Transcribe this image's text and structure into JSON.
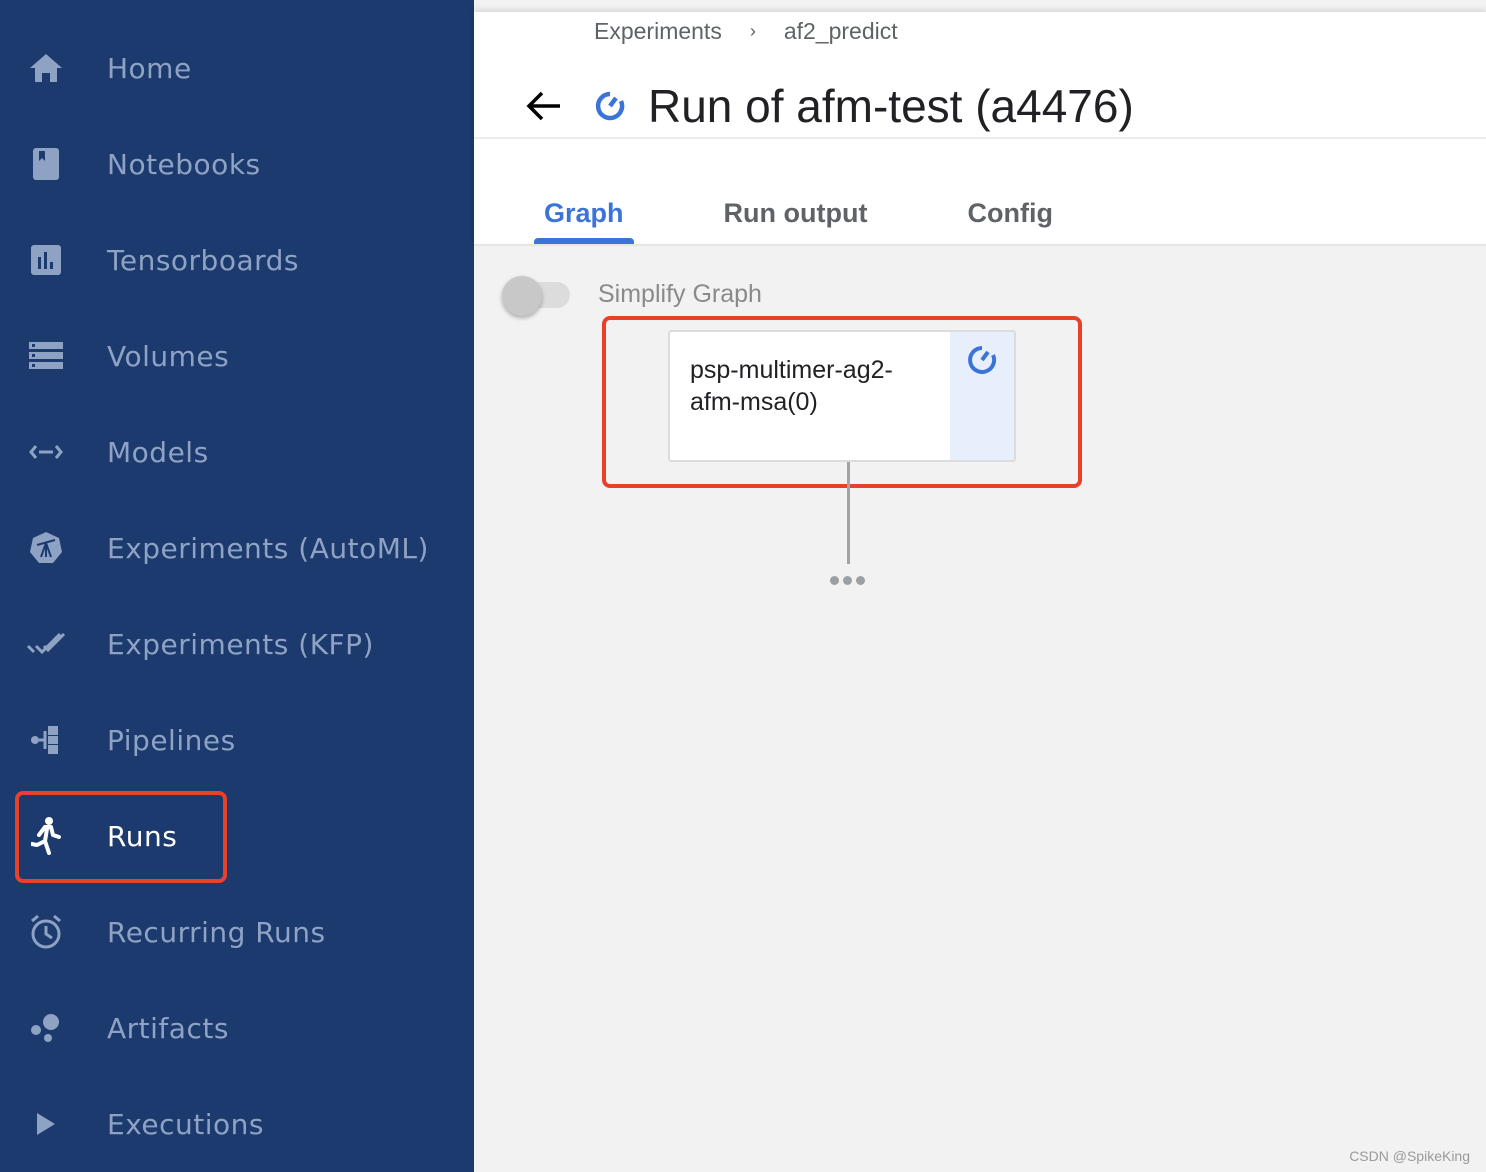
{
  "sidebar": {
    "items": [
      {
        "label": "Home",
        "icon": "home-icon",
        "active": false
      },
      {
        "label": "Notebooks",
        "icon": "notebook-icon",
        "active": false
      },
      {
        "label": "Tensorboards",
        "icon": "bar-chart-icon",
        "active": false
      },
      {
        "label": "Volumes",
        "icon": "storage-icon",
        "active": false
      },
      {
        "label": "Models",
        "icon": "arrows-left-right-icon",
        "active": false
      },
      {
        "label": "Experiments (AutoML)",
        "icon": "telescope-icon",
        "active": false
      },
      {
        "label": "Experiments (KFP)",
        "icon": "double-check-icon",
        "active": false
      },
      {
        "label": "Pipelines",
        "icon": "pipeline-icon",
        "active": false
      },
      {
        "label": "Runs",
        "icon": "running-person-icon",
        "active": true
      },
      {
        "label": "Recurring Runs",
        "icon": "alarm-clock-icon",
        "active": false
      },
      {
        "label": "Artifacts",
        "icon": "bubbles-icon",
        "active": false
      },
      {
        "label": "Executions",
        "icon": "play-icon",
        "active": false
      }
    ]
  },
  "header": {
    "breadcrumb": [
      "Experiments",
      "af2_predict"
    ],
    "breadcrumb_separator": "›",
    "title": "Run of afm-test (a4476)",
    "status": "running",
    "tabs": [
      {
        "label": "Graph",
        "active": true
      },
      {
        "label": "Run output",
        "active": false
      },
      {
        "label": "Config",
        "active": false
      }
    ]
  },
  "graph": {
    "simplify_toggle": {
      "label": "Simplify Graph",
      "on": false
    },
    "nodes": [
      {
        "label": "psp-multimer-ag2-afm-msa(0)",
        "status": "running"
      }
    ],
    "more_indicator": "more-nodes"
  },
  "colors": {
    "sidebar_bg": "#1c3a6e",
    "accent": "#3a74d8",
    "highlight": "#e8402b"
  },
  "watermark": "CSDN @SpikeKing"
}
